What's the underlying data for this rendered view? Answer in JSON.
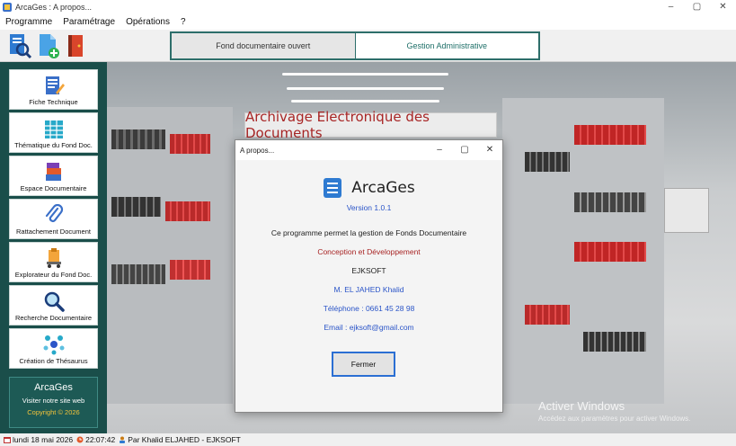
{
  "window": {
    "title": "ArcaGes : A propos...",
    "controls": [
      "–",
      "▢",
      "✕"
    ]
  },
  "menu": [
    "Programme",
    "Paramétrage",
    "Opérations",
    "?"
  ],
  "tabs": {
    "active": "Fond documentaire ouvert",
    "inactive": "Gestion Administrative"
  },
  "sidebar": {
    "items": [
      {
        "label": "Fiche Technique",
        "icon": "fiche-technique-icon"
      },
      {
        "label": "Thématique du Fond Doc.",
        "icon": "thematique-grid-icon"
      },
      {
        "label": "Espace Documentaire",
        "icon": "books-icon"
      },
      {
        "label": "Rattachement Document",
        "icon": "paperclip-icon"
      },
      {
        "label": "Explorateur du Fond Doc.",
        "icon": "cart-explorer-icon"
      },
      {
        "label": "Recherche Documentaire",
        "icon": "magnifier-icon"
      },
      {
        "label": "Création de Thésaurus",
        "icon": "network-dots-icon"
      }
    ],
    "info": {
      "name": "ArcaGes",
      "site": "Visiter notre site web",
      "copyright": "Copyright © 2026"
    }
  },
  "banner": "Archivage Electronique des Documents",
  "watermark": {
    "line1": "Activer Windows",
    "line2": "Accédez aux paramètres pour activer Windows."
  },
  "dialog": {
    "title": "A propos...",
    "controls": [
      "–",
      "▢",
      "✕"
    ],
    "app_name": "ArcaGes",
    "version": "Version 1.0.1",
    "description": "Ce programme permet la gestion de Fonds Documentaire",
    "conception": "Conception et Développement",
    "company": "EJKSOFT",
    "author": "M. EL JAHED Khalid",
    "phone": "Téléphone  : 0661 45 28 98",
    "email": "Email : ejksoft@gmail.com",
    "close_button": "Fermer"
  },
  "status": {
    "date": "lundi 18 mai 2026",
    "time": "22:07:42",
    "user": "Par Khalid ELJAHED - EJKSOFT"
  },
  "colors": {
    "sidebar": "#1a4e4a",
    "tab_border": "#2d6e6a",
    "banner_text": "#a82525",
    "dialog_blue": "#2b55c8",
    "dialog_red": "#a82525"
  }
}
